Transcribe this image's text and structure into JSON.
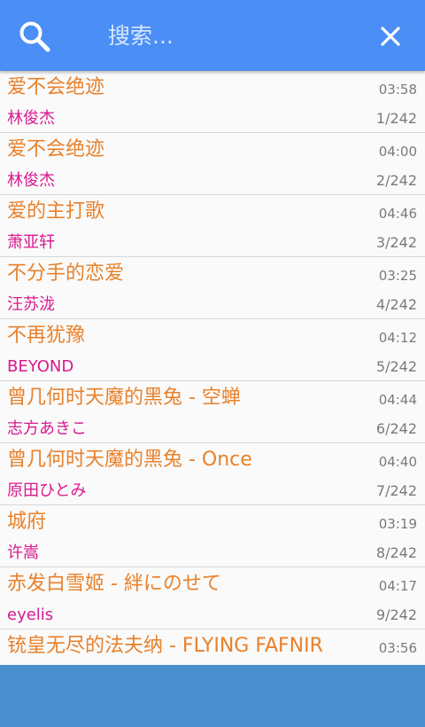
{
  "header": {
    "search_placeholder": "搜索...",
    "search_value": "",
    "accent_color": "#4b8ef6"
  },
  "songs": [
    {
      "title": "爱不会绝迹",
      "artist": "林俊杰",
      "duration": "03:58",
      "index": "1/242"
    },
    {
      "title": "爱不会绝迹",
      "artist": "林俊杰",
      "duration": "04:00",
      "index": "2/242"
    },
    {
      "title": "爱的主打歌",
      "artist": "萧亚轩",
      "duration": "04:46",
      "index": "3/242"
    },
    {
      "title": "不分手的恋爱",
      "artist": "汪苏泷",
      "duration": "03:25",
      "index": "4/242"
    },
    {
      "title": "不再犹豫",
      "artist": "BEYOND",
      "duration": "04:12",
      "index": "5/242"
    },
    {
      "title": "曾几何时天魔的黑兔 - 空蝉",
      "artist": "志方あきこ",
      "duration": "04:44",
      "index": "6/242"
    },
    {
      "title": "曾几何时天魔的黑兔 - Once",
      "artist": "原田ひとみ",
      "duration": "04:40",
      "index": "7/242"
    },
    {
      "title": "城府",
      "artist": "许嵩",
      "duration": "03:19",
      "index": "8/242"
    },
    {
      "title": "赤发白雪姬 - 絆にのせて",
      "artist": "eyelis",
      "duration": "04:17",
      "index": "9/242"
    },
    {
      "title": "铳皇无尽的法夫纳 - FLYING FAFNIR",
      "artist": "",
      "duration": "03:56",
      "index": ""
    }
  ],
  "colors": {
    "title": "#e8812b",
    "artist": "#d9198f",
    "meta": "#7a7a7a",
    "bottom_bar": "#4a8fcd"
  }
}
